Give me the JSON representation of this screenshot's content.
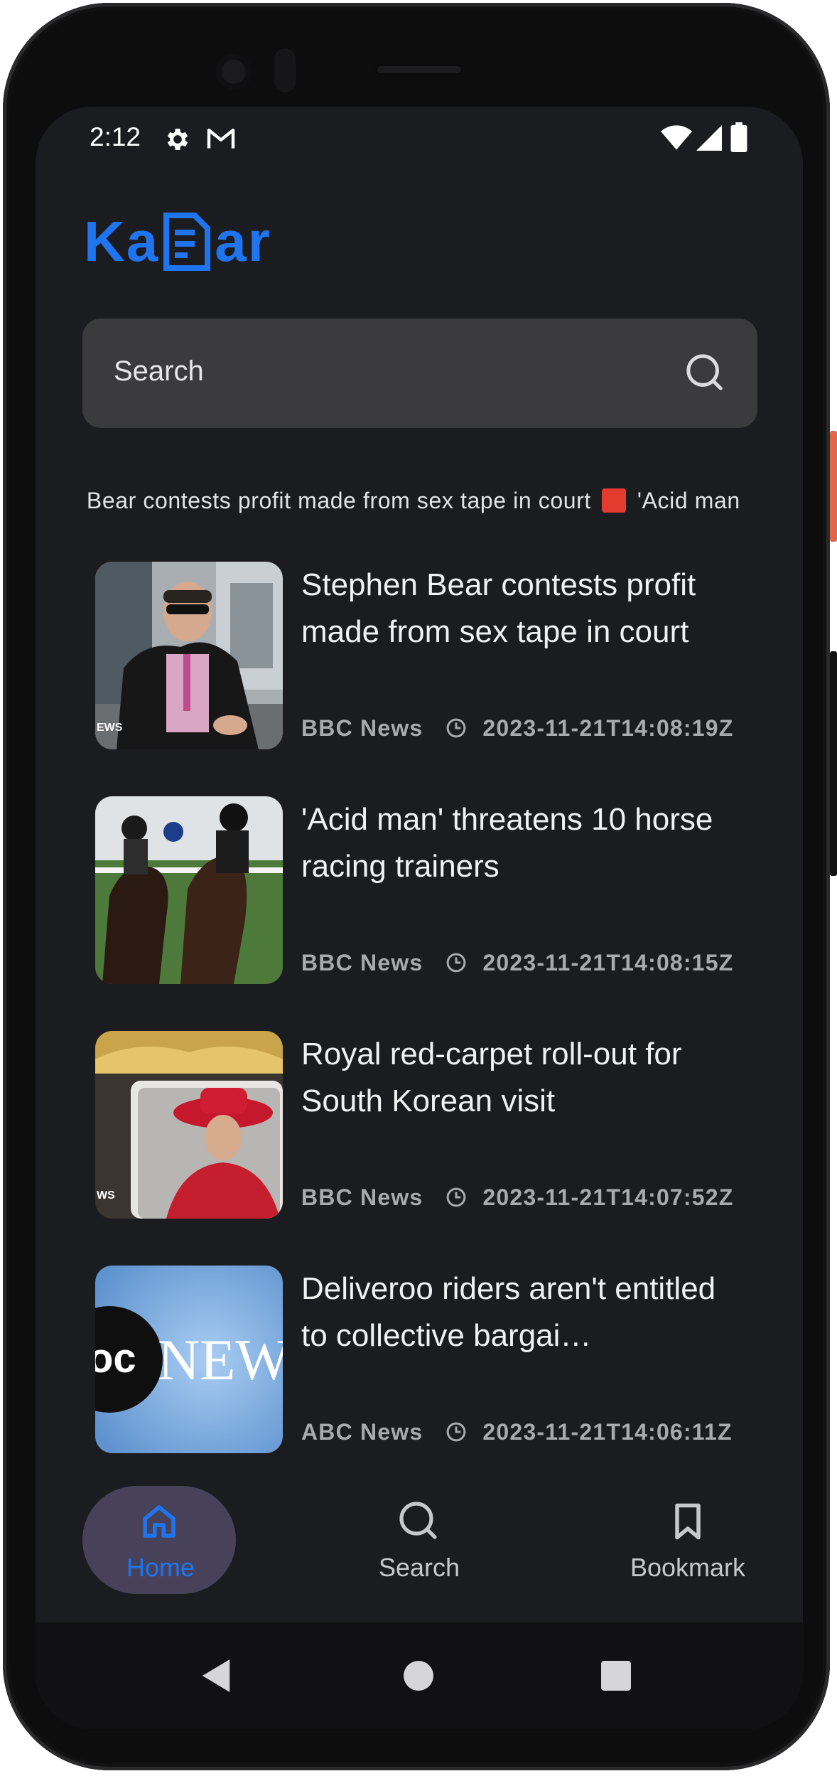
{
  "status_bar": {
    "time": "2:12",
    "icons": [
      "gear-icon",
      "gmail-icon",
      "wifi-icon",
      "signal-icon",
      "battery-icon"
    ]
  },
  "app": {
    "logo_left": "Ka",
    "logo_right": "ar",
    "accent_color": "#1f75f0"
  },
  "search": {
    "placeholder": "Search"
  },
  "ticker": {
    "text_1": "n Bear contests profit made from sex tape in court",
    "text_2": "'Acid man"
  },
  "articles": [
    {
      "title": "Stephen Bear contests profit made from sex tape in court",
      "source": "BBC News",
      "published": "2023-11-21T14:08:19Z",
      "thumbnail_label": "EWS"
    },
    {
      "title": "'Acid man' threatens 10 horse racing trainers",
      "source": "BBC News",
      "published": "2023-11-21T14:08:15Z"
    },
    {
      "title": "Royal red-carpet roll-out for South Korean visit",
      "source": "BBC News",
      "published": "2023-11-21T14:07:52Z",
      "thumbnail_label": "WS"
    },
    {
      "title": "Deliveroo riders aren't entitled to collective bargai…",
      "source": "ABC News",
      "published": "2023-11-21T14:06:11Z",
      "thumbnail_label": "NEW"
    }
  ],
  "bottom_nav": {
    "items": [
      {
        "label": "Home",
        "icon": "home-icon",
        "active": true
      },
      {
        "label": "Search",
        "icon": "search-icon",
        "active": false
      },
      {
        "label": "Bookmark",
        "icon": "bookmark-icon",
        "active": false
      }
    ]
  }
}
